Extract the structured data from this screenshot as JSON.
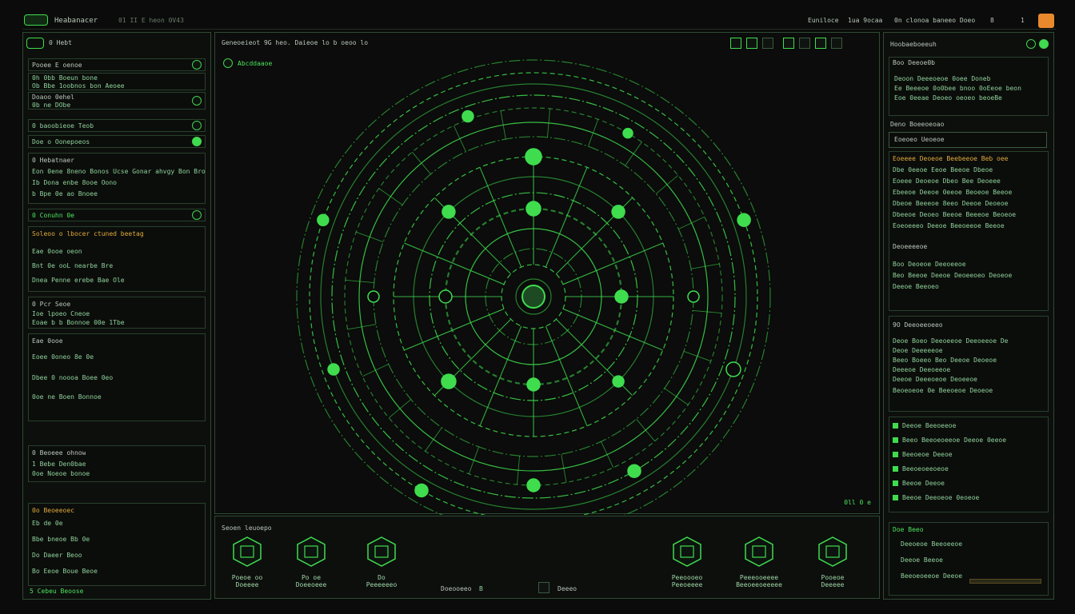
{
  "titlebar": {
    "app_name": "Heabanacer",
    "subtitle": "01 II E heon 0V43",
    "menu": [
      "Euniloce",
      "1ua 9ocaa",
      "0n clonoa baneeo Doeo",
      "8",
      "1"
    ]
  },
  "left_panel": {
    "header": "0 Hebt",
    "sections": [
      {
        "title": "Pooee E oenoe",
        "lines": [
          "0h 0bb Boeun bone",
          "Ob Bbe 1oobnos bon Aeoee"
        ]
      },
      {
        "title": "Doaoo 0ehel",
        "lines": [
          "0b ne DObe"
        ]
      },
      {
        "title": "0 baoobieoe Teob",
        "lines": []
      },
      {
        "title": "Doe o Oonepoeos",
        "lines": []
      },
      {
        "title": "0 Hebatnaer",
        "lines": [
          "Eon 0ene 8neno Bonos Ucse Gonar ahvgy Bon Bro",
          "Ib Dona enbe 8ooe Oono",
          "b Bpe 0e ao Bnoee"
        ]
      },
      {
        "title": "0 Conuhn 0e",
        "lines": []
      },
      {
        "title": "Soleoo o lbocer ctuned beetag",
        "lines": [
          "Eae 0ooe oeon",
          "Bnt 0e ooL nearbe Bre",
          "Dnea Penne erebe Bae Ole"
        ]
      },
      {
        "title": "0 Pcr Seoe",
        "lines": [
          "Ioe lpoeo Cneoe",
          "Eoae b b Bonnoe 00e 1Tbe"
        ]
      },
      {
        "title": "Eae 0ooe",
        "lines": [
          "Eoee 0oneo 8e 0e",
          "Dbee 0 noooa Boee 0eo",
          "0oe ne Boen Bonnoe"
        ]
      },
      {
        "title": "0 Beoeee ohnow",
        "lines": [
          "1 Bebe Den0bae",
          "0oe Noeoe bonoe"
        ]
      },
      {
        "title": "0o Beoeeoec",
        "lines": [
          "Eb de 0e",
          "Bbe bneoe Bb 0e",
          "Do Daeer Beoo",
          "Bo Eeoe Boue Beoe"
        ]
      }
    ],
    "footer": "5 Cebeu Beoose"
  },
  "center": {
    "header_text": "Geneoeieot 9G heo. Daieoe lo b oeoo lo",
    "breadcrumb": "Abcddaaoe",
    "toolbar_icons": [
      "grid-icon",
      "window-icon",
      "pin-icon",
      "bug-icon",
      "link-icon",
      "flag-icon",
      "ruler-icon"
    ],
    "corner_label": "0ll 0 e",
    "tools_header": "Seoen leuoepo",
    "tools": [
      {
        "icon": "pyramid-icon",
        "label": "Poeoe oo\nDoeeee"
      },
      {
        "icon": "notebook-icon",
        "label": "Po oe\nDoeeoeee"
      },
      {
        "icon": "cube-icon",
        "label": "Do\nPeeeeeeo"
      },
      {
        "icon": "gear-bug-icon",
        "label": "Peeoooeo\nPeeoeeee"
      },
      {
        "icon": "circuit-icon",
        "label": "Peeeooeeee\nBeeoeeoeeeee"
      },
      {
        "icon": "chip-icon",
        "label": "Pooeoe\nDeeeee"
      }
    ],
    "status_left": "Doeooeeo",
    "status_count": "B",
    "status_right": "Deeeo"
  },
  "right_panel": {
    "header": "Hoobaeboeeuh",
    "block1_title": "Boo Deeoe0b",
    "block1_lines": [
      "Deoon Deeeoeoe 0oee Doneb",
      "Ee Beeeoe 0o0bee bnoo 0oEeoe beon",
      "Eoe 0eeae Deoeo oeoeo beoeBe"
    ],
    "search_label": "Deno Boeeoeoao",
    "search_value": "Eoeoeo Ueoeoe",
    "highlight_title": "Eoeeee Deoeoe Beebeeoe Beb oee",
    "lines2": [
      "Dbe 0eeoe Eeoe Beeoe Dbeoe",
      "Eoeee Deoeoe Dbeo Bee Deoeee",
      "Ebeeoe Deeoe 0eeoe Beoeoe Beeoe",
      "Dbeoe Beeeoe 8eeo Deeoe Deoeoe",
      "Dbeeoe Deoeo Beeoe Beeeoe Beoeoe",
      "Eoeoeeeo Deeoe Beeoeeoe Beeoe"
    ],
    "sub_title": "Deoeeeeoe",
    "sub_lines": [
      "Boo Deoeoe Deeoeeoe",
      "Beo Beeoe Deeoe Deoeeoeo Deoeoe",
      "Deeoe Beeoeo"
    ],
    "block2_title": "9O Deeoeeoeeo",
    "block2_lines": [
      "Deoe Boeo Deeoeeoe Deeoeeoe De",
      "Deoe Deeeeeoe",
      "Beeo Boeeo Beo Deeoe Deoeoe",
      "Deeeoe Deeoeeoe",
      "Deeoe Deeeoeoe Deoeeoe",
      "Beoeoeoe 0e Beeoeoe Deoeoe"
    ],
    "list_items": [
      "Deeoe Beeoeeoe",
      "Beeo Beeoeoeeoe Deeoe 0eeoe",
      "Beeoeoe Deeoe",
      "Beeoeoeeoeoe",
      "Beeoe Deeoe",
      "Beeoe Deeoeoe 0eoeoe"
    ],
    "footer_title": "Doe Beeo",
    "footer_items": [
      "Deeoeoe Beeoeeoe",
      "Deeoe Beeoe",
      "Beeoeoeeoe Deeoe"
    ]
  },
  "colors": {
    "accent": "#3fdc4e",
    "highlight": "#e2a93b",
    "border": "#2f4a33",
    "bg": "#0a0b0a"
  }
}
